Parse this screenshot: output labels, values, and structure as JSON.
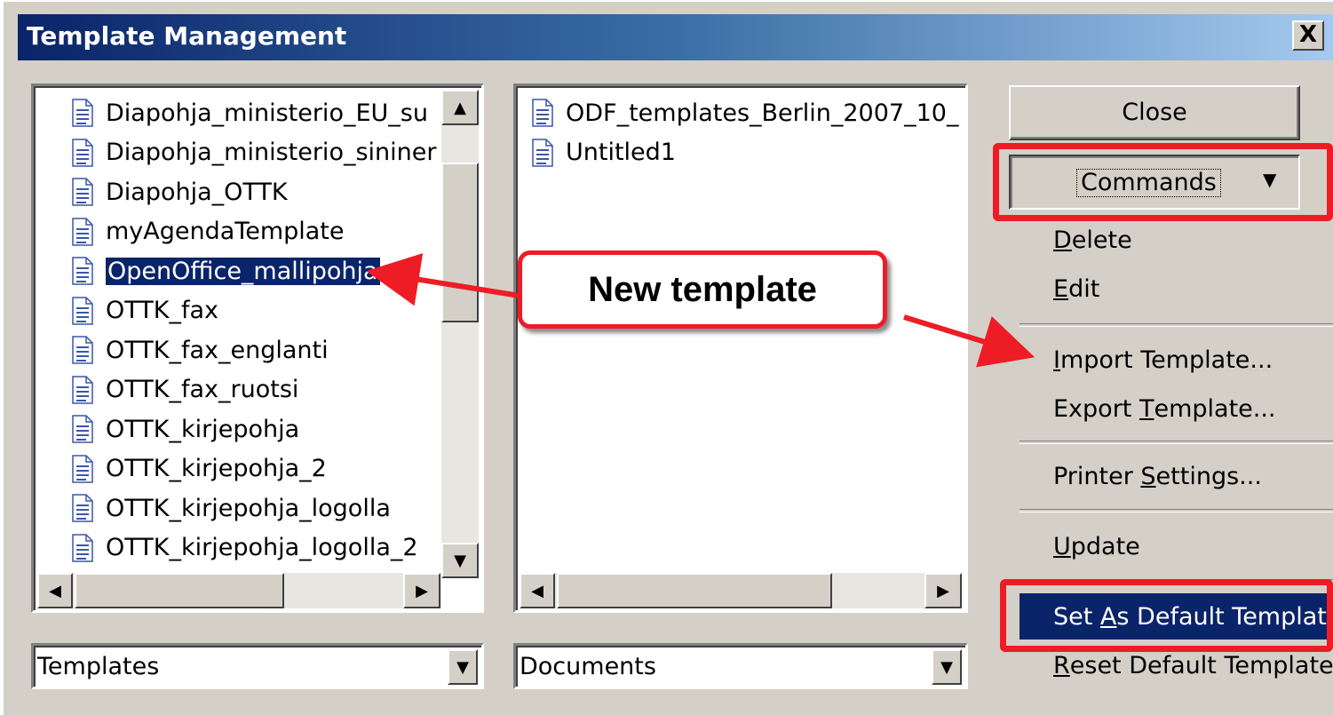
{
  "window": {
    "title": "Template Management",
    "close_glyph": "X"
  },
  "left_list": {
    "items": [
      "Diapohja_ministerio_EU_su",
      "Diapohja_ministerio_sininer",
      "Diapohja_OTTK",
      "myAgendaTemplate",
      "OpenOffice_mallipohja",
      "OTTK_fax",
      "OTTK_fax_englanti",
      "OTTK_fax_ruotsi",
      "OTTK_kirjepohja",
      "OTTK_kirjepohja_2",
      "OTTK_kirjepohja_logolla",
      "OTTK_kirjepohja_logolla_2"
    ],
    "selected_index": 4,
    "icon": "document-icon"
  },
  "right_list": {
    "items": [
      "ODF_templates_Berlin_2007_10_",
      "Untitled1"
    ],
    "icon": "document-icon"
  },
  "left_combo": {
    "value": "Templates"
  },
  "right_combo": {
    "value": "Documents"
  },
  "buttons": {
    "close": "Close",
    "commands": "Commands"
  },
  "commands_menu": {
    "items": [
      {
        "key": "delete",
        "pre": "",
        "mn": "D",
        "post": "elete"
      },
      {
        "key": "edit",
        "pre": "",
        "mn": "E",
        "post": "dit"
      },
      {
        "key": "import",
        "pre": "",
        "mn": "I",
        "post": "mport Template..."
      },
      {
        "key": "export",
        "pre": "Export ",
        "mn": "T",
        "post": "emplate..."
      },
      {
        "key": "printer",
        "pre": "Printer ",
        "mn": "S",
        "post": "ettings..."
      },
      {
        "key": "update",
        "pre": "",
        "mn": "U",
        "post": "pdate"
      },
      {
        "key": "setdefault",
        "pre": "Set ",
        "mn": "A",
        "post": "s Default Templat"
      },
      {
        "key": "reset",
        "pre": "",
        "mn": "R",
        "post": "eset Default Template"
      }
    ],
    "highlighted_key": "setdefault"
  },
  "annotation": {
    "callout": "New template"
  },
  "colors": {
    "annotation_red": "#ee1c25",
    "selection": "#0a246a",
    "face": "#d4d0c8"
  }
}
